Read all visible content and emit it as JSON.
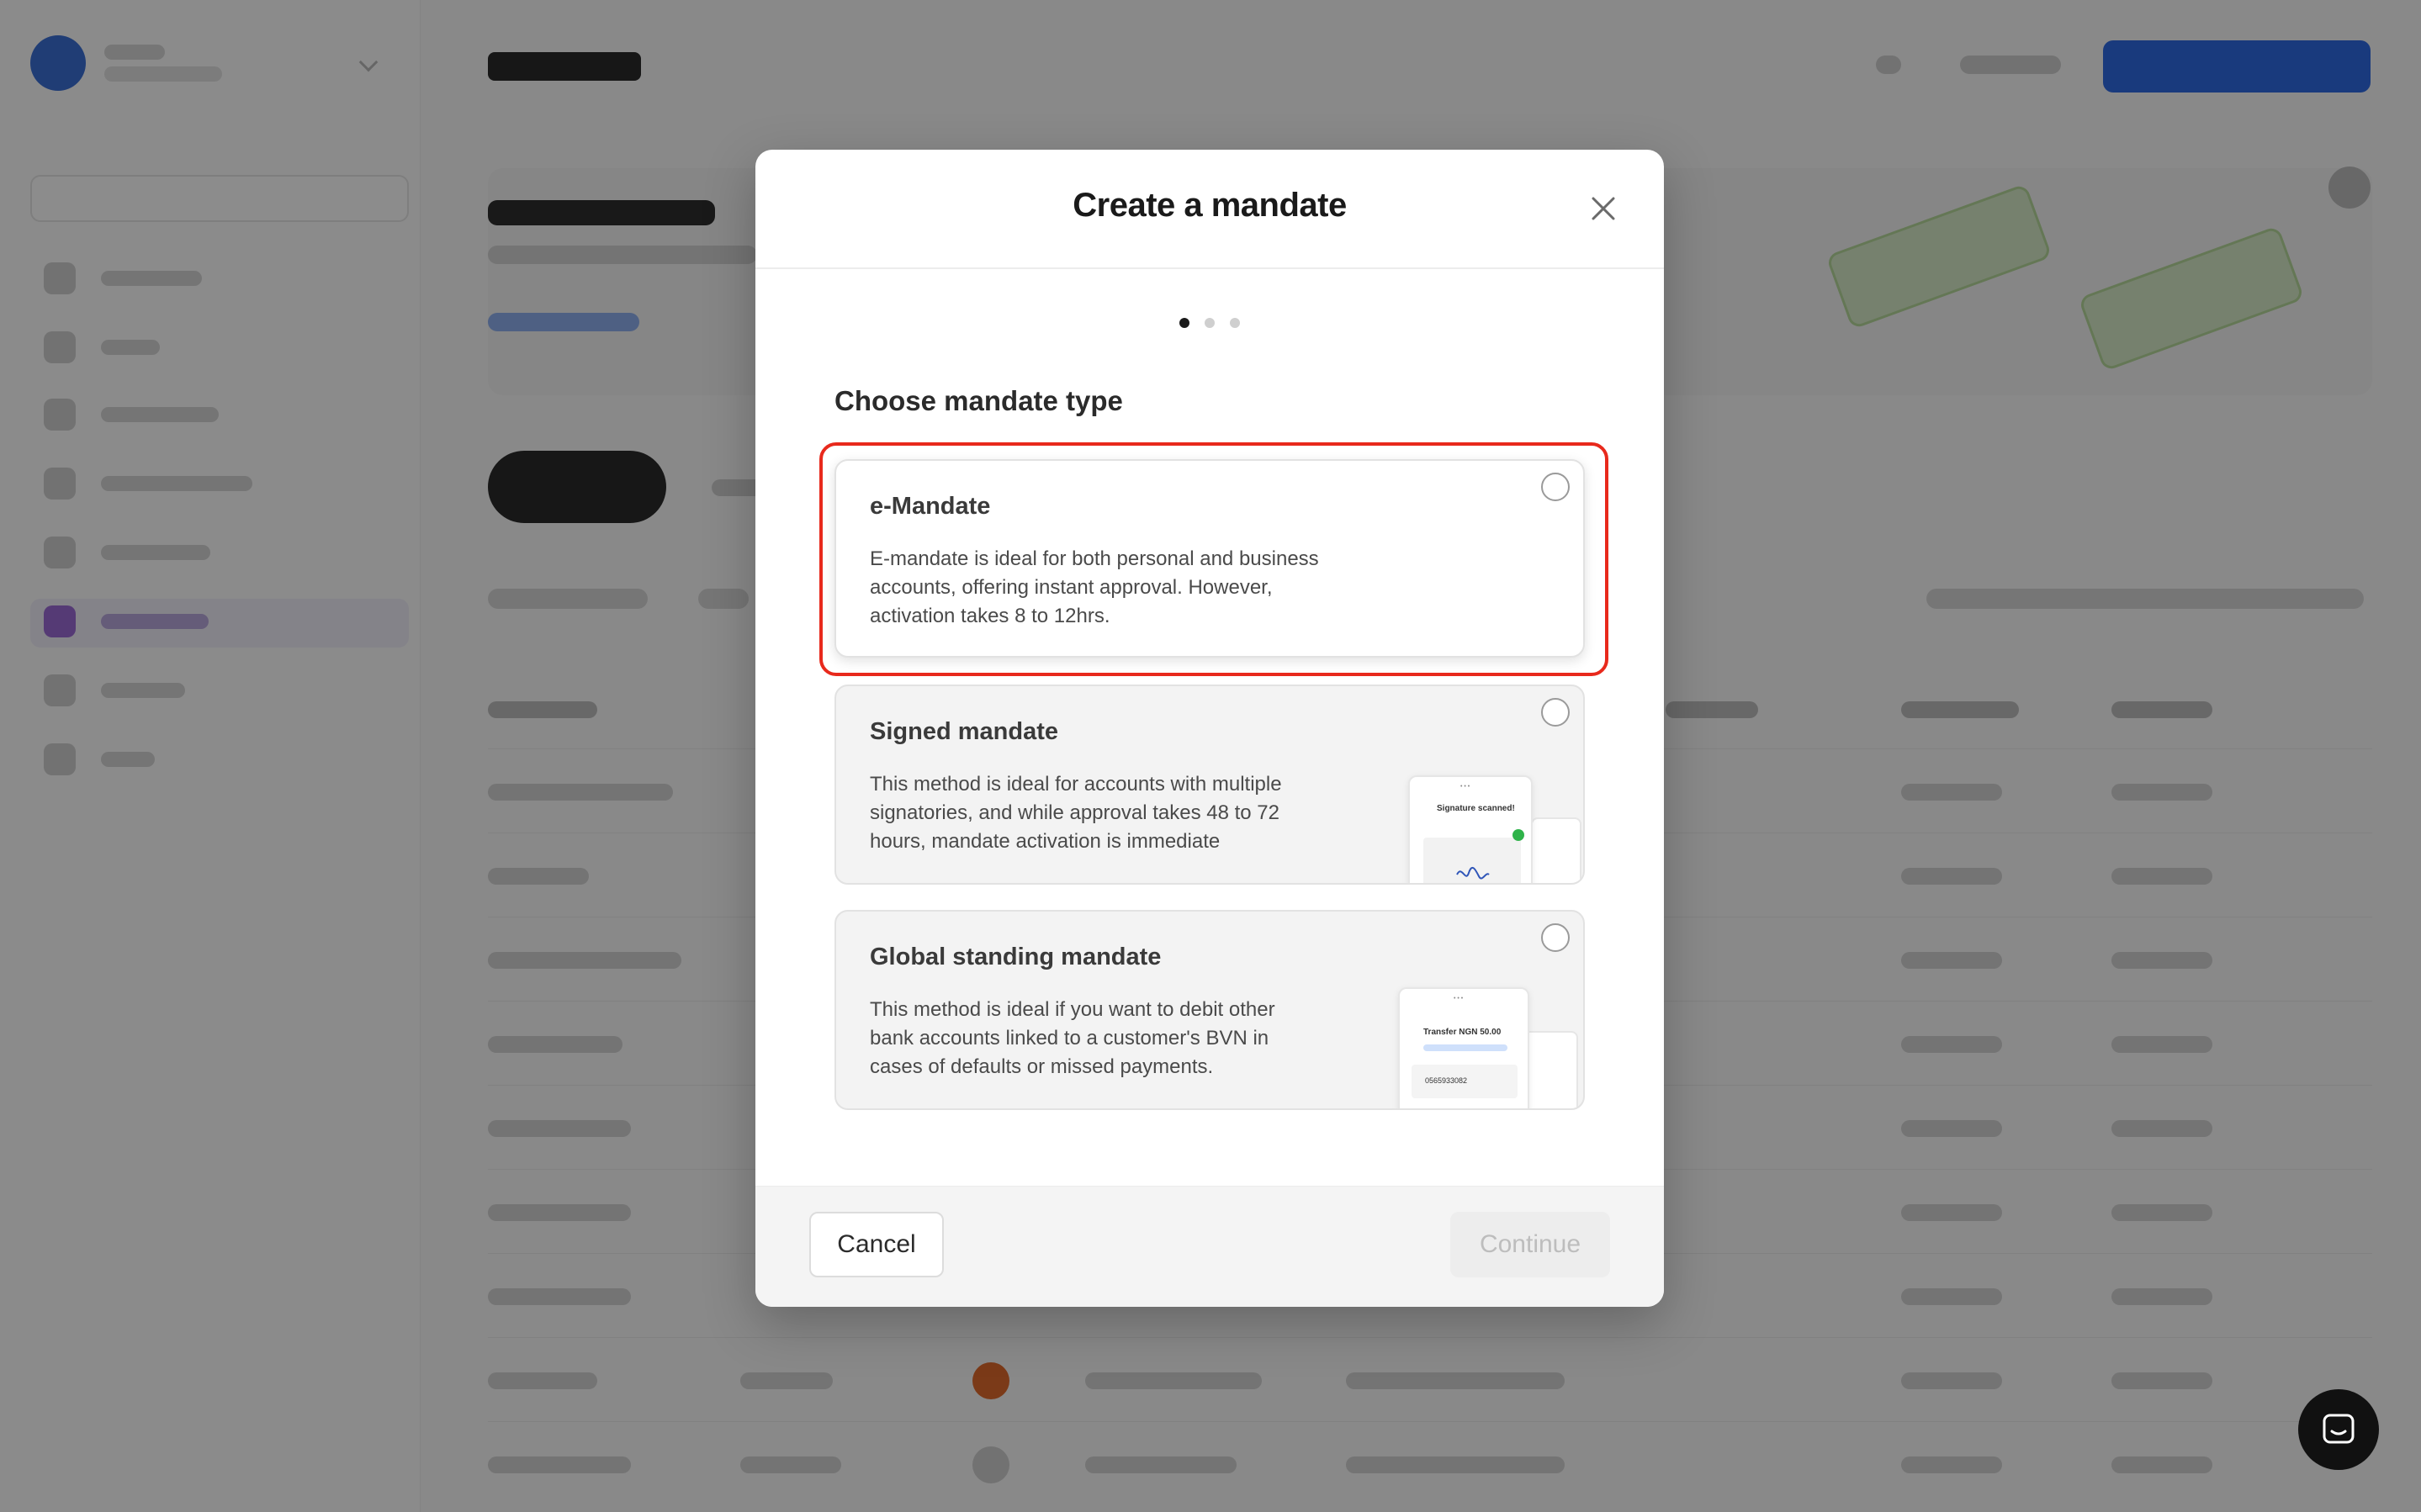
{
  "modal": {
    "title": "Create a mandate",
    "step_current": 1,
    "step_total": 3,
    "section_label": "Choose mandate type",
    "options": [
      {
        "title": "e-Mandate",
        "description": "E-mandate is ideal for both personal and business accounts, offering instant approval. However, activation takes 8 to 12hrs.",
        "highlighted": true
      },
      {
        "title": "Signed mandate",
        "description": "This method is ideal for accounts with multiple signatories, and while approval takes 48 to 72 hours, mandate activation is immediate",
        "preview_text": "Signature scanned!"
      },
      {
        "title": "Global standing mandate",
        "description": "This method is ideal if you want to debit other bank accounts linked to a customer's BVN in cases of defaults or missed payments.",
        "preview_text": "Transfer NGN 50.00",
        "preview_number": "0565933082"
      }
    ],
    "cancel_label": "Cancel",
    "continue_label": "Continue"
  },
  "colors": {
    "highlight": "#e8291c",
    "primary": "#2f6be3",
    "overlay": "rgba(0,0,0,0.45)"
  },
  "icons": {
    "close": "close-icon",
    "chat": "chat-icon"
  }
}
